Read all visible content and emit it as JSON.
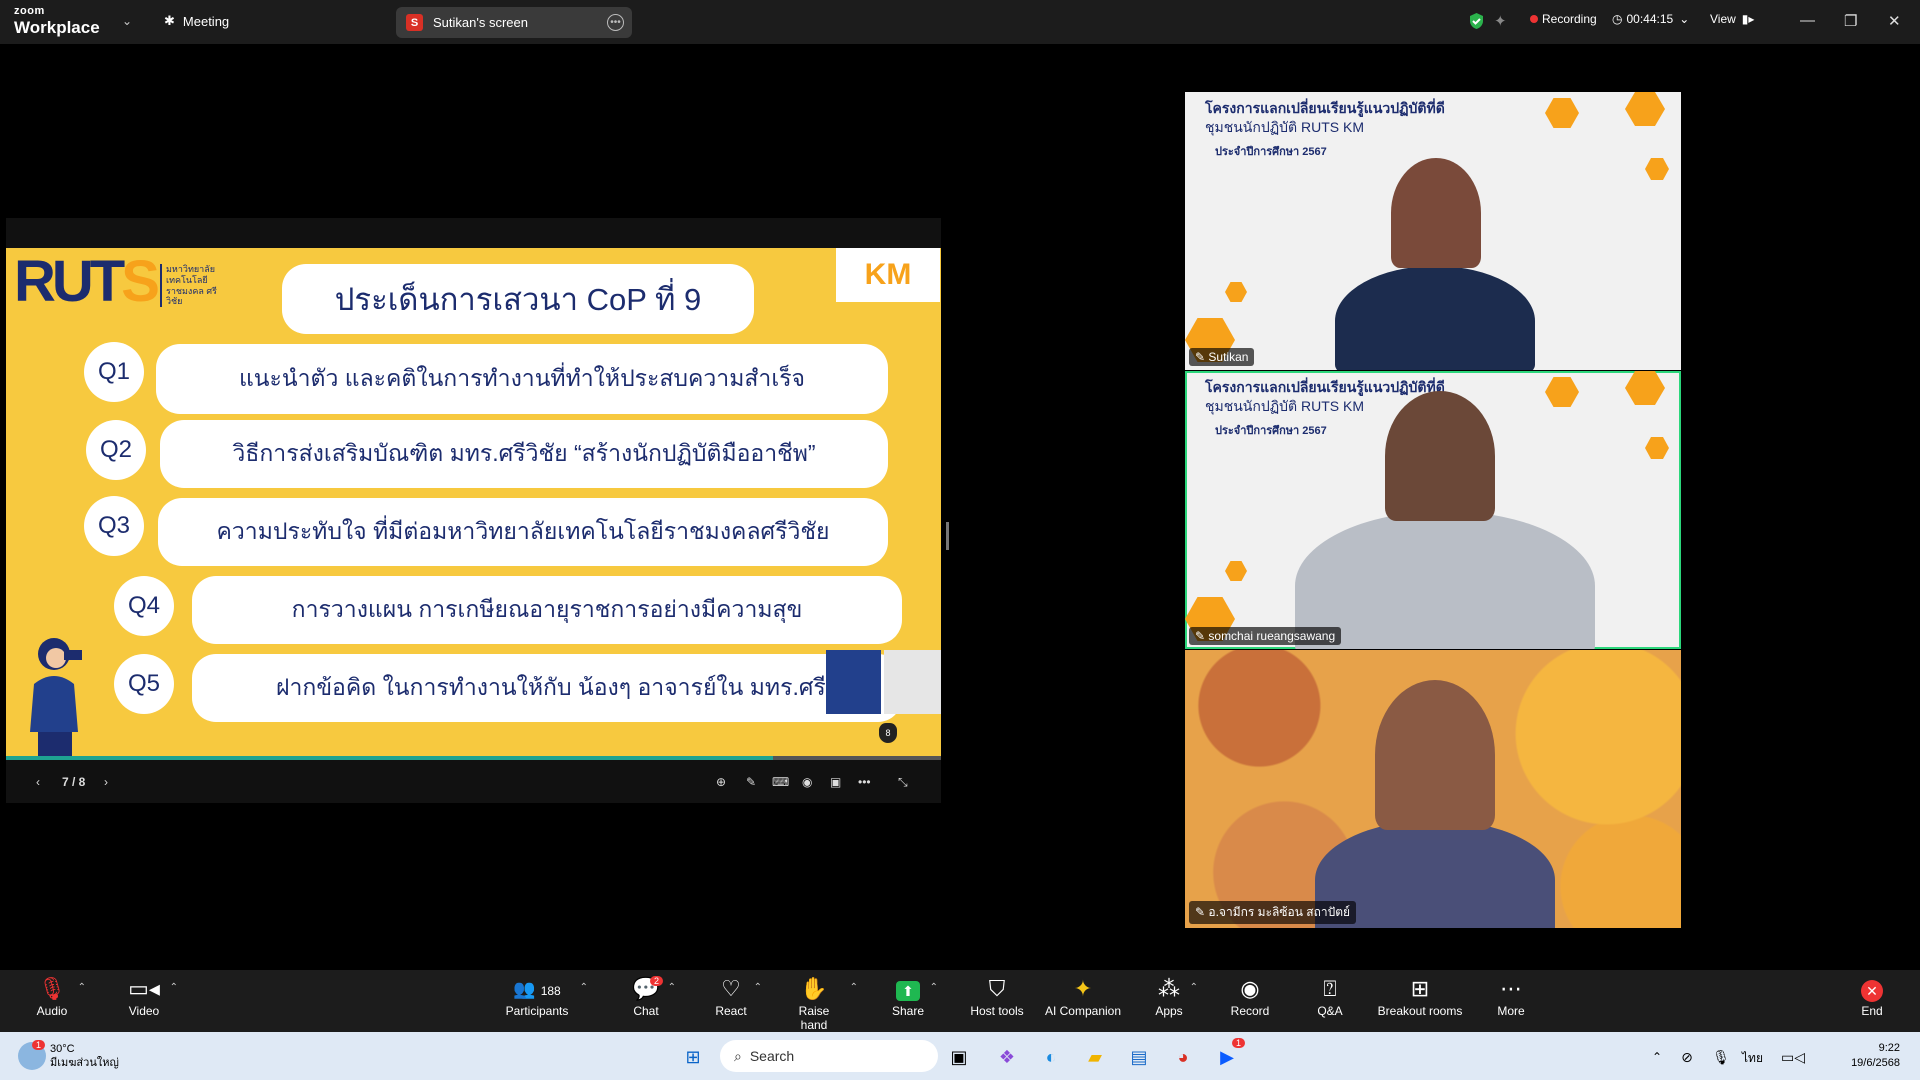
{
  "topbar": {
    "logo_top": "zoom",
    "logo_bottom": "Workplace",
    "meeting_label": "Meeting",
    "screen_badge": "S",
    "screen_label": "Sutikan's screen",
    "recording_label": "Recording",
    "timer": "00:44:15",
    "view_label": "View"
  },
  "slide": {
    "brand": "RUTS",
    "brand_sub": "มหาวิทยาลัย เทคโนโลยีราชมงคล ศรีวิชัย",
    "km_logo": "KM",
    "title": "ประเด็นการเสวนา CoP ที่ 9",
    "questions": [
      {
        "id": "Q1",
        "text": "แนะนำตัว และคติในการทำงานที่ทำให้ประสบความสำเร็จ"
      },
      {
        "id": "Q2",
        "text": "วิธีการส่งเสริมบัณฑิต มทร.ศรีวิชัย “สร้างนักปฏิบัติมืออาชีพ”"
      },
      {
        "id": "Q3",
        "text": "ความประทับใจ ที่มีต่อมหาวิทยาลัยเทคโนโลยีราชมงคลศรีวิชัย"
      },
      {
        "id": "Q4",
        "text": "การวางแผน การเกษียณอายุราชการอย่างมีความสุข"
      },
      {
        "id": "Q5",
        "text": "ฝากข้อคิด ในการทำงานให้กับ น้องๆ อาจารย์ใน มทร.ศรีวิชัย"
      }
    ],
    "page_badge": "8",
    "progress": 0.82,
    "page_indicator": "7 / 8"
  },
  "videos": [
    {
      "name": "Sutikan",
      "banner1": "โครงการแลกเปลี่ยนเรียนรู้แนวปฏิบัติที่ดี",
      "banner2": "ชุมชนนักปฏิบัติ RUTS KM",
      "banner3": "ประจำปีการศึกษา 2567"
    },
    {
      "name": "somchai rueangsawang",
      "banner1": "โครงการแลกเปลี่ยนเรียนรู้แนวปฏิบัติที่ดี",
      "banner2": "ชุมชนนักปฏิบัติ RUTS KM",
      "banner3": "ประจำปีการศึกษา 2567"
    },
    {
      "name": "อ.จามีกร มะลิซ้อน สถาปัตย์"
    }
  ],
  "toolbar": {
    "audio": "Audio",
    "video": "Video",
    "participants_count": "188",
    "participants": "Participants",
    "chat_badge": "2",
    "chat": "Chat",
    "react": "React",
    "raise_hand": "Raise hand",
    "share": "Share",
    "host_tools": "Host tools",
    "ai_companion": "AI Companion",
    "apps": "Apps",
    "record": "Record",
    "qa": "Q&A",
    "breakout": "Breakout rooms",
    "more": "More",
    "end": "End"
  },
  "taskbar": {
    "weather_badge": "1",
    "temp": "30°C",
    "weather_desc": "มีเมฆส่วนใหญ่",
    "search_placeholder": "Search",
    "zoom_badge": "1",
    "lang": "ไทย",
    "time": "9:22",
    "date": "19/6/2568"
  },
  "colors": {
    "slide_bg": "#f7c93f",
    "navy": "#1c2c6e",
    "accent": "#f7a21b",
    "active_speaker": "#2bd67b",
    "record": "#e33333"
  }
}
